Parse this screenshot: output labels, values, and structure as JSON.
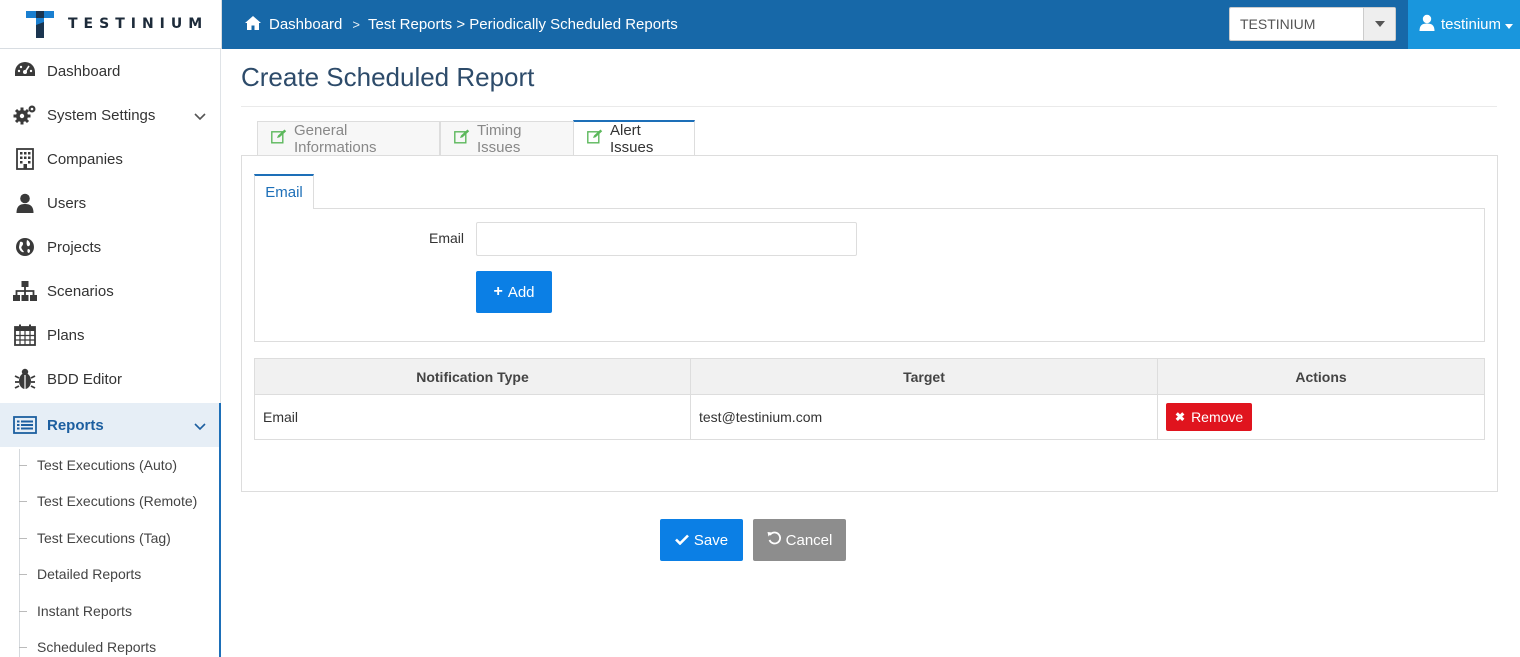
{
  "header": {
    "logo_text": "TESTINIUM",
    "breadcrumb": {
      "home": "Dashboard",
      "path": "Test Reports > Periodically Scheduled Reports"
    },
    "company_select": {
      "value": "TESTINIUM"
    },
    "user": {
      "name": "testinium"
    }
  },
  "sidebar": {
    "items": [
      {
        "label": "Dashboard",
        "icon": "dashboard-icon"
      },
      {
        "label": "System Settings",
        "icon": "gears-icon"
      },
      {
        "label": "Companies",
        "icon": "building-icon"
      },
      {
        "label": "Users",
        "icon": "user-icon"
      },
      {
        "label": "Projects",
        "icon": "globe-icon"
      },
      {
        "label": "Scenarios",
        "icon": "sitemap-icon"
      },
      {
        "label": "Plans",
        "icon": "calendar-icon"
      },
      {
        "label": "BDD Editor",
        "icon": "bug-icon"
      },
      {
        "label": "Reports",
        "icon": "list-icon"
      }
    ],
    "sub_items": [
      {
        "label": "Test Executions (Auto)"
      },
      {
        "label": "Test Executions (Remote)"
      },
      {
        "label": "Test Executions (Tag)"
      },
      {
        "label": "Detailed Reports"
      },
      {
        "label": "Instant Reports"
      },
      {
        "label": "Scheduled Reports"
      }
    ]
  },
  "main": {
    "title": "Create Scheduled Report",
    "tabs": [
      {
        "label": "General Informations"
      },
      {
        "label": "Timing Issues"
      },
      {
        "label": "Alert Issues"
      }
    ],
    "inner_tab": {
      "label": "Email"
    },
    "form": {
      "email_label": "Email",
      "email_value": "",
      "add_label": "Add"
    },
    "table": {
      "headers": [
        "Notification Type",
        "Target",
        "Actions"
      ],
      "rows": [
        {
          "type": "Email",
          "target": "test@testinium.com",
          "action": "Remove"
        }
      ]
    },
    "buttons": {
      "save": "Save",
      "cancel": "Cancel"
    }
  },
  "colors": {
    "topbar": "#1768a8",
    "user_menu": "#1996dd",
    "primary_button": "#0b7fe5",
    "danger_button": "#e0141e",
    "cancel_button": "#8d8d8d"
  }
}
